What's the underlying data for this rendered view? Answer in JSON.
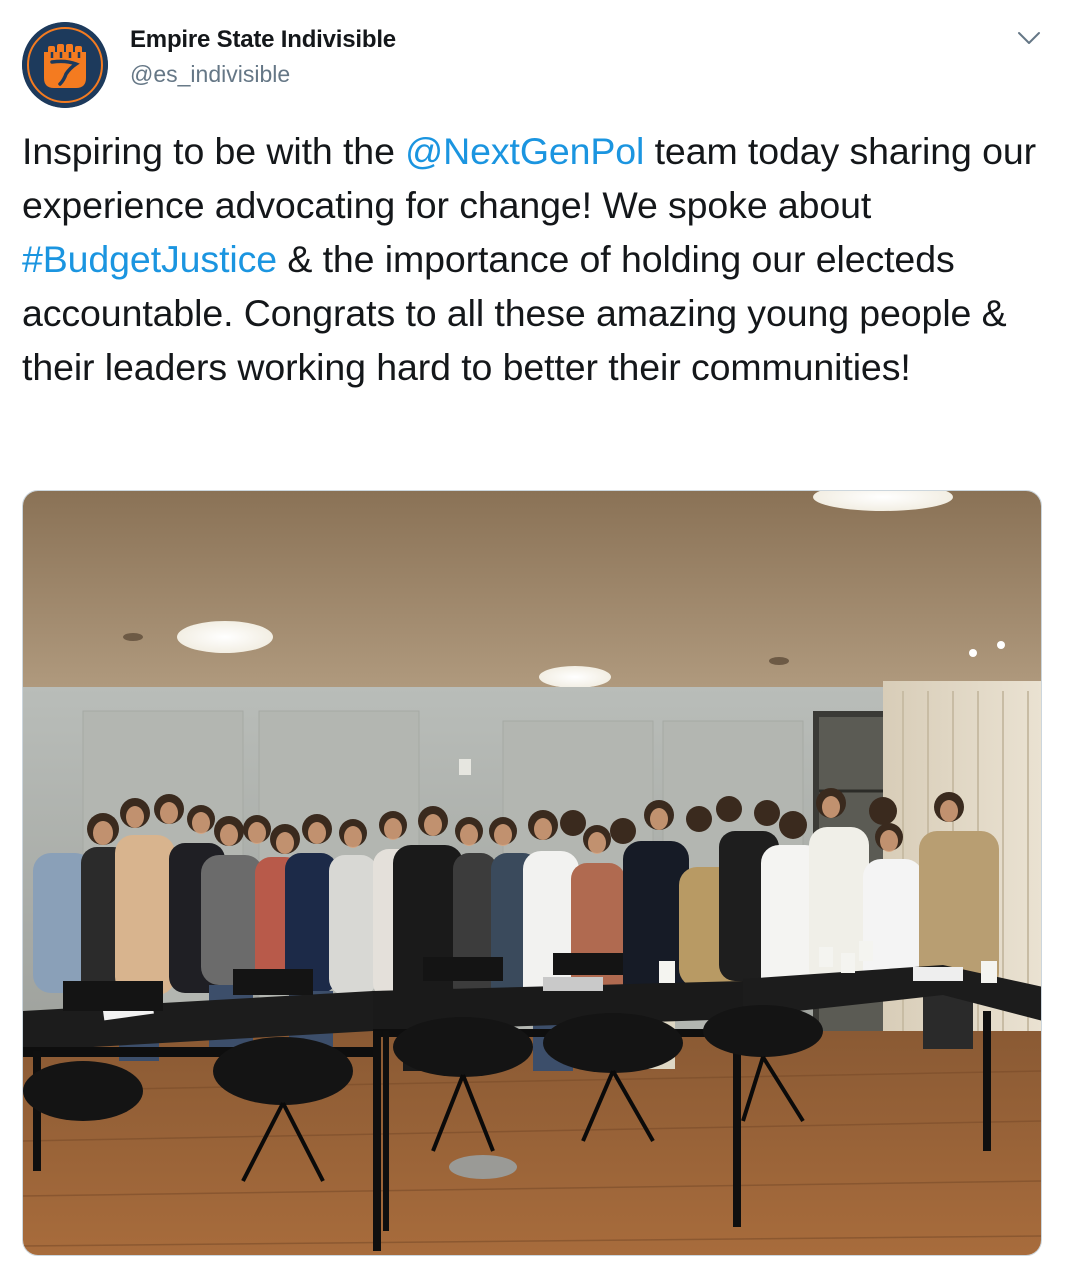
{
  "account": {
    "display_name": "Empire State Indivisible",
    "handle": "@es_indivisible",
    "avatar_icon": "raised-fist-logo",
    "avatar_bg": "#1d3a5c",
    "avatar_accent": "#f47b20"
  },
  "menu": {
    "icon": "chevron-down-icon"
  },
  "tweet": {
    "segments": [
      {
        "text": "Inspiring to be with the ",
        "type": "text"
      },
      {
        "text": "@NextGenPol",
        "type": "mention"
      },
      {
        "text": "  team today sharing our experience advocating for change! We spoke about ",
        "type": "text"
      },
      {
        "text": "#BudgetJustice",
        "type": "hashtag"
      },
      {
        "text": " & the importance of holding our electeds accountable. Congrats to all these amazing young people & their leaders working hard to better their communities!",
        "type": "text"
      }
    ],
    "link_color": "#1b95e0"
  },
  "media": {
    "kind": "photo",
    "subject": "group-photo-conference-room"
  }
}
